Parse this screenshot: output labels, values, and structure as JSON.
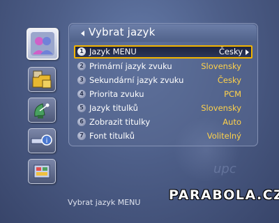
{
  "screen": {
    "title": "Vybrat jazyk",
    "status_hint": "Vybrat jazyk MENU",
    "watermark_brand": "PARABOLA.CZ",
    "background_logo": "upc",
    "colors": {
      "selection_border": "#f2b400",
      "value_text": "#ffd24a",
      "background": "#4d5e88"
    }
  },
  "sidebar": {
    "items": [
      {
        "icon": "user-profile-icon",
        "active": true
      },
      {
        "icon": "folder-files-icon",
        "active": false
      },
      {
        "icon": "satellite-dish-icon",
        "active": false
      },
      {
        "icon": "search-info-icon",
        "active": false
      },
      {
        "icon": "tools-icon",
        "active": false
      }
    ]
  },
  "menu": {
    "items": [
      {
        "num": "1",
        "label": "Jazyk MENU",
        "value": "Česky",
        "selected": true
      },
      {
        "num": "2",
        "label": "Primární jazyk zvuku",
        "value": "Slovensky"
      },
      {
        "num": "3",
        "label": "Sekundární jazyk zvuku",
        "value": "Česky"
      },
      {
        "num": "4",
        "label": "Priorita zvuku",
        "value": "PCM"
      },
      {
        "num": "5",
        "label": "Jazyk titulků",
        "value": "Slovensky"
      },
      {
        "num": "6",
        "label": "Zobrazit titulky",
        "value": "Auto"
      },
      {
        "num": "7",
        "label": "Font titulků",
        "value": "Volitelný"
      }
    ]
  }
}
